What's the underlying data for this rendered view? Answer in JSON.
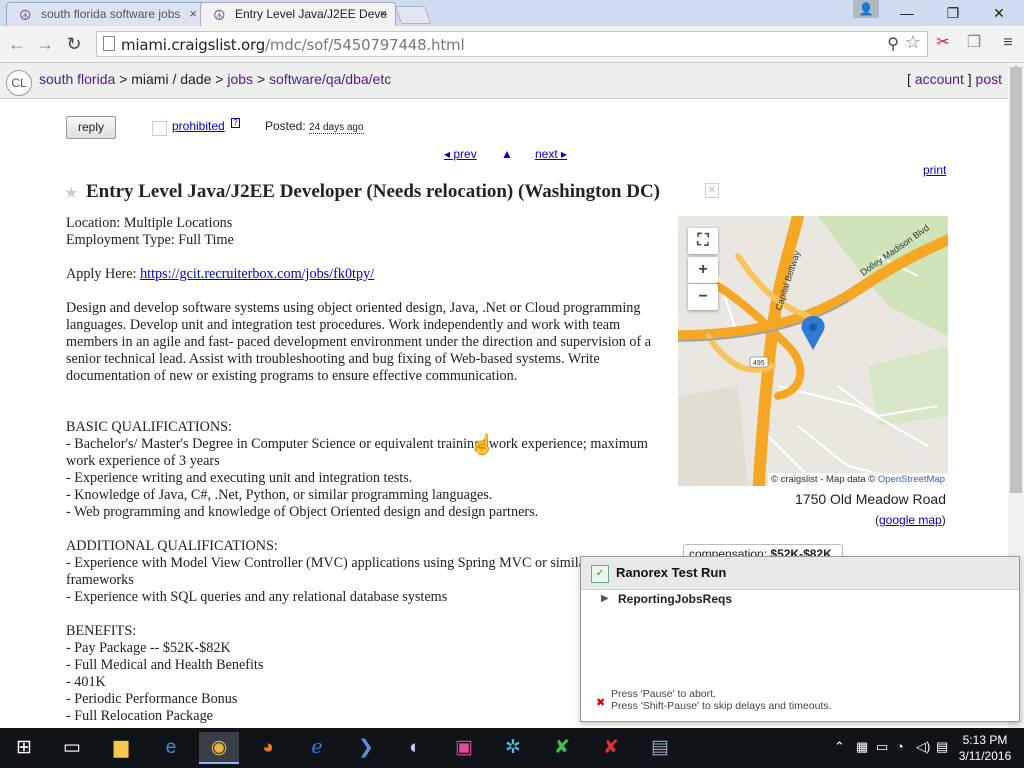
{
  "browser": {
    "tabs": [
      {
        "title": "south florida software jobs",
        "active": false
      },
      {
        "title": "Entry Level Java/J2EE Deve",
        "active": true
      }
    ],
    "tab_close": "×",
    "url_host": "miami.craigslist.org",
    "url_path": "/mdc/sof/5450797448.html",
    "window_controls": {
      "minimize": "—",
      "maximize": "❐",
      "close": "✕"
    }
  },
  "header": {
    "logo": "CL",
    "breadcrumbs": [
      {
        "label": "south florida",
        "link": true
      },
      {
        "label": "miami / dade",
        "link": false
      },
      {
        "label": "jobs",
        "link": true
      },
      {
        "label": "software/qa/dba/etc",
        "link": true
      }
    ],
    "separator": ">",
    "account_link": "account",
    "post_link": "post"
  },
  "actions": {
    "reply": "reply",
    "prohibited": "prohibited",
    "help": "?",
    "posted_label": "Posted:",
    "posted_ago": "24 days ago",
    "prev": "◂ prev",
    "up": "▲",
    "next": "next ▸",
    "print": "print"
  },
  "posting": {
    "title": "Entry Level Java/J2EE Developer (Needs relocation) (Washington DC)",
    "location": "Location: Multiple Locations",
    "employment_type": "Employment Type: Full Time",
    "apply_label": "Apply Here:",
    "apply_url": "https://gcit.recruiterbox.com/jobs/fk0tpy/",
    "description": "Design and develop software systems using object oriented design, Java, .Net or Cloud programming languages. Develop unit and integration test procedures. Work independently and work with team members in an agile and fast- paced development environment under the direction and supervision of a senior technical lead. Assist with troubleshooting and bug fixing of Web-based systems. Write documentation of new or existing programs to ensure effective communication.",
    "basic_heading": "BASIC QUALIFICATIONS:",
    "basic_items": [
      "- Bachelor's/ Master's Degree in Computer Science or equivalent training/ work experience; maximum work experience of 3 years",
      "- Experience writing and executing unit and integration tests.",
      "- Knowledge of Java, C#, .Net, Python, or similar programming languages.",
      "- Web programming and knowledge of Object Oriented design and design partners."
    ],
    "additional_heading": "ADDITIONAL QUALIFICATIONS:",
    "additional_items": [
      "- Experience with Model View Controller (MVC) applications using Spring MVC or similar frameworks",
      "- Experience with SQL queries and any relational database systems"
    ],
    "benefits_heading": "BENEFITS:",
    "benefits_items": [
      "- Pay Package -- $52K-$82K",
      "- Full Medical and Health Benefits",
      "- 401K",
      "- Periodic Performance Bonus",
      "- Full Relocation Package"
    ]
  },
  "map": {
    "zoom_in": "+",
    "zoom_out": "−",
    "fullscreen": "⛶",
    "attribution_prefix": "© craigslist - Map data ©",
    "attribution_osm": "OpenStreetMap",
    "road_labels": [
      "Capital Beltway",
      "Dolley Madison Blvd",
      "495"
    ],
    "address": "1750 Old Meadow Road",
    "google_map": "google map"
  },
  "attributes": {
    "compensation_label": "compensation:",
    "compensation_value": "$52K-$82K"
  },
  "ranorex": {
    "title": "Ranorex Test Run",
    "test_name": "ReportingJobsReqs",
    "hint_line1": "Press 'Pause' to abort.",
    "hint_line2": "Press 'Shift-Pause' to skip delays and timeouts."
  },
  "taskbar": {
    "time": "5:13 PM",
    "date": "3/11/2016"
  },
  "colors": {
    "link_visited": "#551a8b",
    "link": "#0000cc",
    "highway": "#f5a623",
    "map_pin": "#2f7ad6"
  }
}
